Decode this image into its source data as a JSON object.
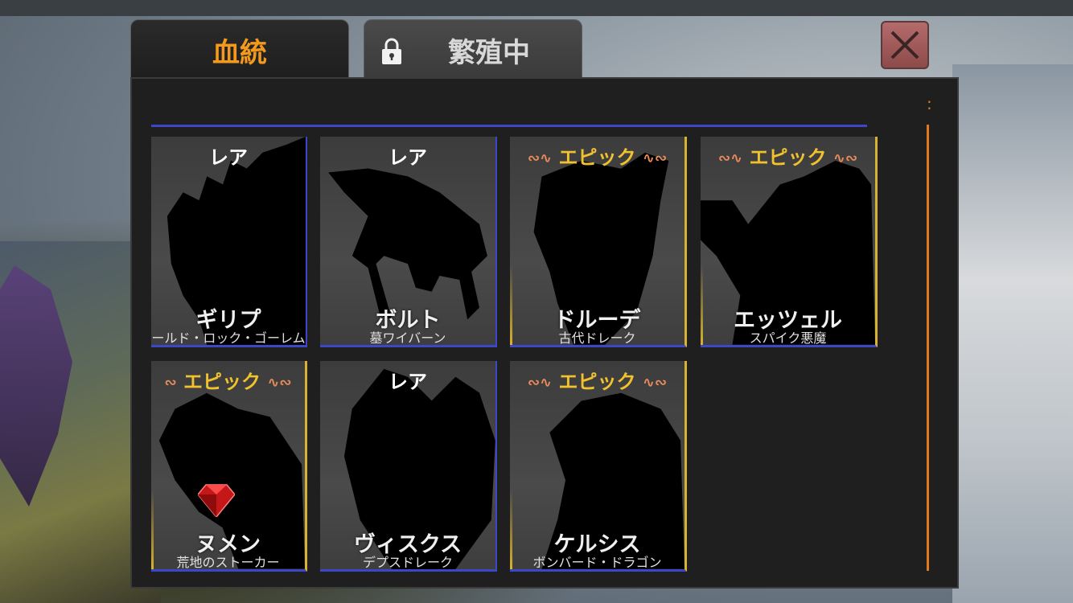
{
  "tabs": [
    {
      "label": "血統",
      "active": true
    },
    {
      "label": "繁殖中",
      "locked": true
    }
  ],
  "close_icon": "close-x",
  "colors": {
    "accent_orange": "#f39a1c",
    "rare_text": "#ffffff",
    "epic_text": "#f2c22e",
    "card_border_blue": "#3c47c8",
    "epic_border_gold": "#d8b230"
  },
  "cards": [
    {
      "rarity": "レア",
      "rarity_type": "rare",
      "name": "ギリプ",
      "subtitle": "ールド・ロック・ゴーレム"
    },
    {
      "rarity": "レア",
      "rarity_type": "rare",
      "name": "ボルト",
      "subtitle": "墓ワイバーン"
    },
    {
      "rarity": "エピック",
      "rarity_type": "epic",
      "name": "ドルーデ",
      "subtitle": "古代ドレーク"
    },
    {
      "rarity": "エピック",
      "rarity_type": "epic",
      "name": "エッツェル",
      "subtitle": "スパイク悪魔"
    },
    {
      "rarity": "エピック",
      "rarity_type": "epic",
      "name": "ヌメン",
      "subtitle": "荒地のストーカー",
      "badge": "red-gem-icon"
    },
    {
      "rarity": "レア",
      "rarity_type": "rare",
      "name": "ヴィスクス",
      "subtitle": "デプスドレーク"
    },
    {
      "rarity": "エピック",
      "rarity_type": "epic",
      "name": "ケルシス",
      "subtitle": "ボンバード・ドラゴン"
    }
  ]
}
